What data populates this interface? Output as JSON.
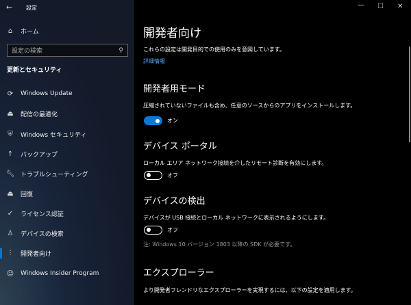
{
  "window": {
    "title": "設定",
    "minimize": "—",
    "maximize": "☐",
    "close": "✕"
  },
  "sidebar": {
    "home": "ホーム",
    "search_placeholder": "設定の検索",
    "section": "更新とセキュリティ",
    "items": [
      {
        "label": "Windows Update",
        "icon": "sync-icon"
      },
      {
        "label": "配信の最適化",
        "icon": "delivery-icon"
      },
      {
        "label": "Windows セキュリティ",
        "icon": "shield-icon"
      },
      {
        "label": "バックアップ",
        "icon": "backup-icon"
      },
      {
        "label": "トラブルシューティング",
        "icon": "wrench-icon"
      },
      {
        "label": "回復",
        "icon": "recovery-icon"
      },
      {
        "label": "ライセンス認証",
        "icon": "check-circle-icon"
      },
      {
        "label": "デバイスの検索",
        "icon": "find-device-icon"
      },
      {
        "label": "開発者向け",
        "icon": "developer-icon",
        "selected": true
      },
      {
        "label": "Windows Insider Program",
        "icon": "insider-icon"
      }
    ]
  },
  "main": {
    "title": "開発者向け",
    "intro": "これらの設定は開発目的での使用のみを意図しています。",
    "link": "詳細情報",
    "dev_mode": {
      "heading": "開発者用モード",
      "desc": "圧縮されていないファイルも含め、任意のソースからのアプリをインストールします。",
      "state": "オン"
    },
    "portal": {
      "heading": "デバイス ポータル",
      "desc": "ローカル エリア ネットワーク接続を介したリモート診断を有効にします。",
      "state": "オフ"
    },
    "discovery": {
      "heading": "デバイスの検出",
      "desc": "デバイスが USB 接続とローカル ネットワークに表示されるようにします。",
      "state": "オフ",
      "note": "注: Windows 10 バージョン 1803 以降の SDK が必要です。"
    },
    "explorer": {
      "heading": "エクスプローラー",
      "desc": "より開発者フレンドリなエクスプローラーを実現するには、以下の設定を適用します。"
    }
  },
  "colors": {
    "accent": "#0078d7",
    "link": "#4aa3f0"
  }
}
